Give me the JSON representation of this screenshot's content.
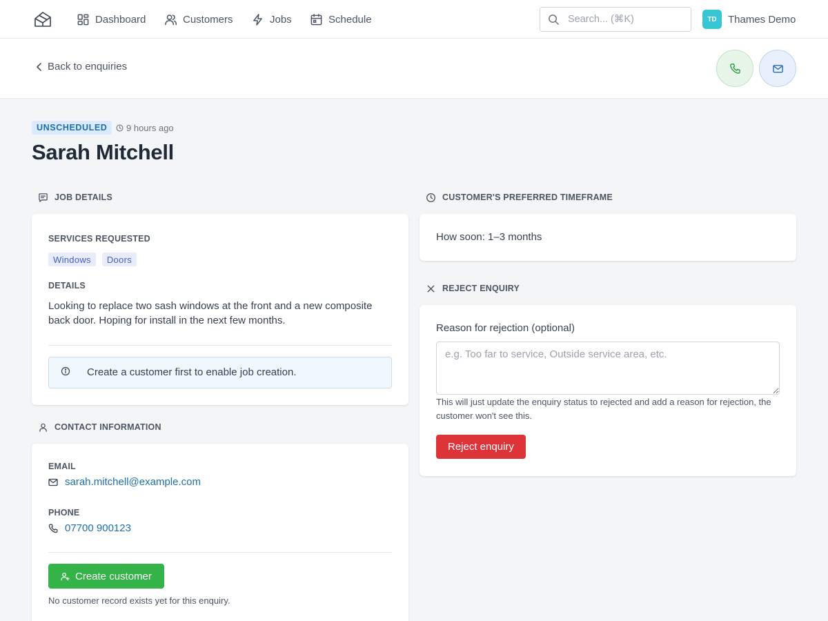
{
  "nav": {
    "logo_icon": "house-logo-icon",
    "items": [
      {
        "label": "Dashboard",
        "icon": "grid-icon"
      },
      {
        "label": "Customers",
        "icon": "users-icon"
      },
      {
        "label": "Jobs",
        "icon": "lightning-icon"
      },
      {
        "label": "Schedule",
        "icon": "calendar-icon"
      }
    ],
    "search": {
      "placeholder": "Search... (⌘K)",
      "value": ""
    },
    "account": {
      "initials": "TD",
      "name": "Thames Demo",
      "avatar_color": "#38c6d4"
    }
  },
  "subheader": {
    "back_label": "Back to enquiries",
    "call_icon": "phone-icon",
    "email_icon": "mail-icon"
  },
  "enquiry": {
    "status": "UNSCHEDULED",
    "time_ago": "9 hours ago",
    "name": "Sarah Mitchell"
  },
  "job_details": {
    "heading": "JOB DETAILS",
    "services_label": "SERVICES REQUESTED",
    "services": [
      "Windows",
      "Doors"
    ],
    "details_label": "DETAILS",
    "details_text": "Looking to replace two sash windows at the front and a new composite back door. Hoping for install in the next few months.",
    "info_text": "Create a customer first to enable job creation."
  },
  "contact": {
    "heading": "CONTACT INFORMATION",
    "email_label": "EMAIL",
    "email": "sarah.mitchell@example.com",
    "phone_label": "PHONE",
    "phone": "07700 900123",
    "create_button": "Create customer",
    "note": "No customer record exists yet for this enquiry."
  },
  "timeframe": {
    "heading": "CUSTOMER'S PREFERRED TIMEFRAME",
    "text": "How soon: 1–3 months"
  },
  "reject": {
    "heading": "REJECT ENQUIRY",
    "field_label": "Reason for rejection (optional)",
    "placeholder": "e.g. Too far to service, Outside service area, etc.",
    "value": "",
    "help_text": "This will just update the enquiry status to rejected and add a reason for rejection, the customer won't see this.",
    "button": "Reject enquiry"
  },
  "colors": {
    "status_badge_bg": "#dbeafe",
    "status_badge_text": "#1d6fa8",
    "link": "#1d6fa8",
    "create_button": "#34b348",
    "reject_button": "#dc3438",
    "call_button": "#e8f6ea",
    "email_button": "#e8f1fb"
  }
}
